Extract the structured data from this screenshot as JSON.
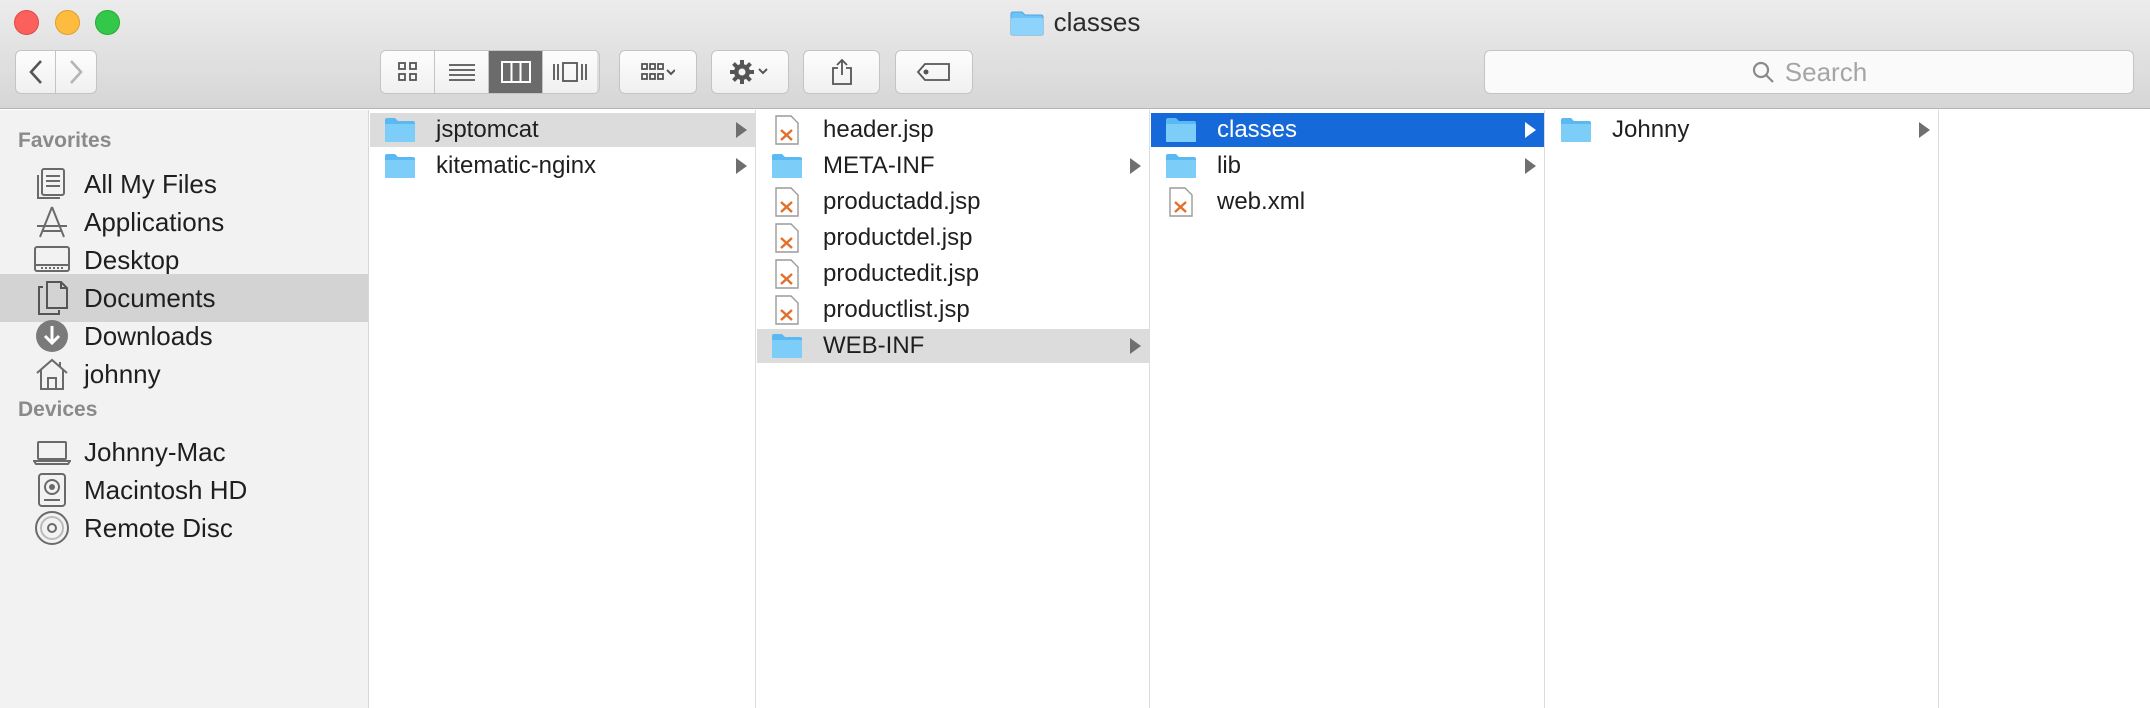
{
  "window": {
    "title": "classes"
  },
  "toolbar": {
    "search_placeholder": "Search",
    "view_modes": [
      "icon-view",
      "list-view",
      "column-view",
      "cover-flow-view"
    ],
    "active_view": "column-view"
  },
  "sidebar": {
    "favorites_header": "Favorites",
    "favorites": [
      {
        "label": "All My Files",
        "icon": "all-files-icon"
      },
      {
        "label": "Applications",
        "icon": "applications-icon"
      },
      {
        "label": "Desktop",
        "icon": "desktop-icon"
      },
      {
        "label": "Documents",
        "icon": "documents-icon",
        "selected": true
      },
      {
        "label": "Downloads",
        "icon": "downloads-icon"
      },
      {
        "label": "johnny",
        "icon": "home-icon"
      }
    ],
    "devices_header": "Devices",
    "devices": [
      {
        "label": "Johnny-Mac",
        "icon": "laptop-icon"
      },
      {
        "label": "Macintosh HD",
        "icon": "hard-disk-icon"
      },
      {
        "label": "Remote Disc",
        "icon": "disc-icon"
      }
    ]
  },
  "columns": [
    {
      "items": [
        {
          "name": "jsptomcat",
          "type": "folder",
          "state": "path"
        },
        {
          "name": "kitematic-nginx",
          "type": "folder"
        }
      ]
    },
    {
      "items": [
        {
          "name": "header.jsp",
          "type": "file"
        },
        {
          "name": "META-INF",
          "type": "folder"
        },
        {
          "name": "productadd.jsp",
          "type": "file"
        },
        {
          "name": "productdel.jsp",
          "type": "file"
        },
        {
          "name": "productedit.jsp",
          "type": "file"
        },
        {
          "name": "productlist.jsp",
          "type": "file"
        },
        {
          "name": "WEB-INF",
          "type": "folder",
          "state": "path"
        }
      ]
    },
    {
      "items": [
        {
          "name": "classes",
          "type": "folder",
          "state": "selected"
        },
        {
          "name": "lib",
          "type": "folder"
        },
        {
          "name": "web.xml",
          "type": "file"
        }
      ]
    },
    {
      "items": [
        {
          "name": "Johnny",
          "type": "folder"
        }
      ]
    }
  ],
  "colors": {
    "selection_blue": "#1569d8",
    "folder_blue": "#6cc3f7",
    "sidebar_bg": "#f2f2f2"
  }
}
